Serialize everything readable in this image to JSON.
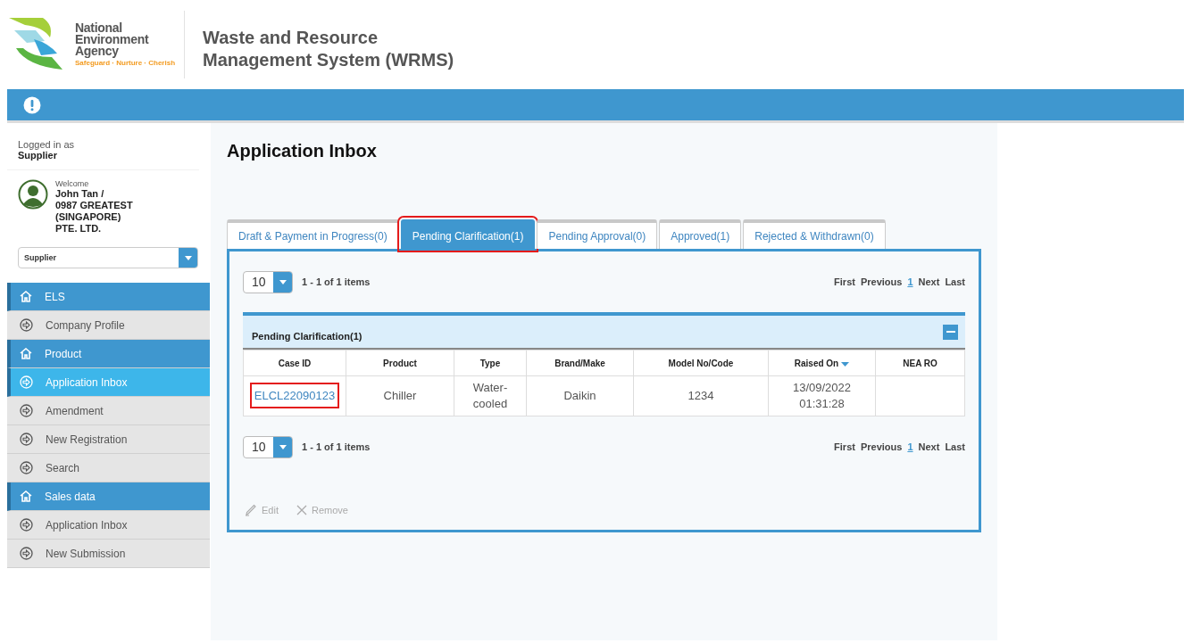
{
  "logo": {
    "name_lines": [
      "National",
      "Environment",
      "Agency"
    ],
    "tagline": "Safeguard · Nurture · Cherish"
  },
  "app_title_lines": [
    "Waste and Resource",
    "Management System (WRMS)"
  ],
  "user": {
    "logged_in_label": "Logged in as",
    "role": "Supplier",
    "welcome": "Welcome",
    "name_lines": [
      "John Tan /",
      "0987 GREATEST",
      "(SINGAPORE)",
      "PTE. LTD."
    ],
    "role_select": "Supplier"
  },
  "sidebar": {
    "items": [
      {
        "kind": "section",
        "label": "ELS",
        "selected": false
      },
      {
        "kind": "item",
        "label": "Company Profile",
        "selected": false
      },
      {
        "kind": "section",
        "label": "Product",
        "selected": false
      },
      {
        "kind": "item",
        "label": "Application Inbox",
        "selected": true
      },
      {
        "kind": "item",
        "label": "Amendment",
        "selected": false
      },
      {
        "kind": "item",
        "label": "New Registration",
        "selected": false
      },
      {
        "kind": "item",
        "label": "Search",
        "selected": false
      },
      {
        "kind": "section",
        "label": "Sales data",
        "selected": false
      },
      {
        "kind": "item",
        "label": "Application Inbox",
        "selected": false
      },
      {
        "kind": "item",
        "label": "New Submission",
        "selected": false
      }
    ]
  },
  "page_title": "Application Inbox",
  "tabs": [
    {
      "label": "Draft & Payment in Progress(0)",
      "selected": false,
      "highlighted": false
    },
    {
      "label": "Pending Clarification(1)",
      "selected": true,
      "highlighted": true
    },
    {
      "label": "Pending Approval(0)",
      "selected": false,
      "highlighted": false
    },
    {
      "label": "Approved(1)",
      "selected": false,
      "highlighted": false
    },
    {
      "label": "Rejected & Withdrawn(0)",
      "selected": false,
      "highlighted": false
    }
  ],
  "pager_top": {
    "page_size": "10",
    "summary": "1 - 1 of 1 items",
    "links": [
      {
        "label": "First",
        "selected": false
      },
      {
        "label": "Previous",
        "selected": false
      },
      {
        "label": "1",
        "selected": true
      },
      {
        "label": "Next",
        "selected": false
      },
      {
        "label": "Last",
        "selected": false
      }
    ]
  },
  "group": {
    "title": "Pending Clarification(1)",
    "expanded": true
  },
  "table": {
    "columns": [
      {
        "label": "Case ID",
        "sorted": false
      },
      {
        "label": "Product",
        "sorted": false
      },
      {
        "label": "Type",
        "sorted": false
      },
      {
        "label": "Brand/Make",
        "sorted": false
      },
      {
        "label": "Model No/Code",
        "sorted": false
      },
      {
        "label": "Raised On",
        "sorted": true
      },
      {
        "label": "NEA RO",
        "sorted": false
      }
    ],
    "rows": [
      {
        "case_id_highlighted": true,
        "cells": [
          "ELCL22090123",
          "Chiller",
          "Water-cooled",
          "Daikin",
          "1234",
          "13/09/2022 01:31:28",
          ""
        ]
      }
    ]
  },
  "pager_bottom": {
    "page_size": "10",
    "summary": "1 - 1 of 1 items",
    "links": [
      {
        "label": "First",
        "selected": false
      },
      {
        "label": "Previous",
        "selected": false
      },
      {
        "label": "1",
        "selected": true
      },
      {
        "label": "Next",
        "selected": false
      },
      {
        "label": "Last",
        "selected": false
      }
    ]
  },
  "actions": [
    {
      "kind": "edit",
      "label": "Edit",
      "disabled": true
    },
    {
      "kind": "remove",
      "label": "Remove",
      "disabled": true
    }
  ]
}
